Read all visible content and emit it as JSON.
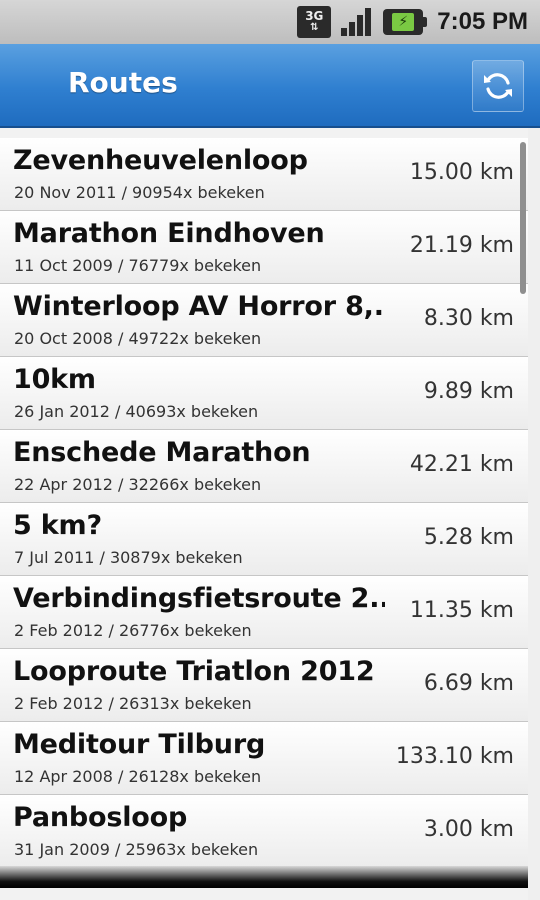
{
  "status_bar": {
    "network": "3G",
    "time": "7:05 PM"
  },
  "action_bar": {
    "title": "Routes",
    "refresh_icon": "refresh-icon"
  },
  "routes": [
    {
      "name": "Zevenheuvelenloop",
      "meta": "20 Nov 2011 / 90954x bekeken",
      "distance": "15.00 km"
    },
    {
      "name": "Marathon Eindhoven",
      "meta": "11 Oct 2009 / 76779x bekeken",
      "distance": "21.19 km"
    },
    {
      "name": "Winterloop AV Horror 8,...",
      "meta": "20 Oct 2008 / 49722x bekeken",
      "distance": "8.30 km"
    },
    {
      "name": "10km",
      "meta": "26 Jan 2012 / 40693x bekeken",
      "distance": "9.89 km"
    },
    {
      "name": "Enschede Marathon",
      "meta": "22 Apr 2012 / 32266x bekeken",
      "distance": "42.21 km"
    },
    {
      "name": "5 km?",
      "meta": "7 Jul 2011 / 30879x bekeken",
      "distance": "5.28 km"
    },
    {
      "name": "Verbindingsfietsroute 2...",
      "meta": "2 Feb 2012 / 26776x bekeken",
      "distance": "11.35 km"
    },
    {
      "name": "Looproute Triatlon 2012",
      "meta": "2 Feb 2012 / 26313x bekeken",
      "distance": "6.69 km"
    },
    {
      "name": "Meditour Tilburg",
      "meta": "12 Apr 2008 / 26128x bekeken",
      "distance": "133.10 km"
    },
    {
      "name": "Panbosloop",
      "meta": "31 Jan 2009 / 25963x bekeken",
      "distance": "3.00 km"
    }
  ],
  "colors": {
    "action_bar": "#2f7fd0",
    "row_text": "#111111"
  }
}
